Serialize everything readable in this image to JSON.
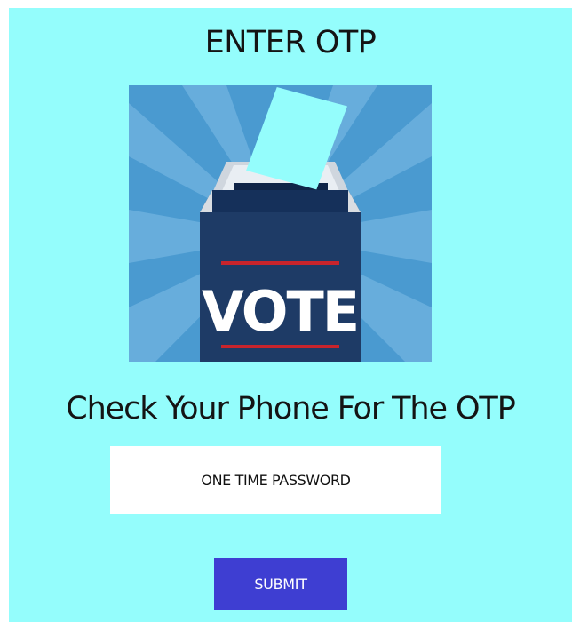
{
  "page": {
    "title": "ENTER OTP",
    "subtitle": "Check Your Phone For The OTP",
    "background_color": "#94fdfc"
  },
  "illustration": {
    "icon": "ballot-box-icon",
    "box_label": "VOTE",
    "colors": {
      "background": "#4a9ad0",
      "box": "#1e3b66",
      "stripe": "#c8242c",
      "ballot": "#94fdfc"
    }
  },
  "form": {
    "otp_placeholder": "ONE TIME PASSWORD",
    "otp_value": "",
    "submit_label": "SUBMIT",
    "submit_color": "#3e3ed2"
  }
}
